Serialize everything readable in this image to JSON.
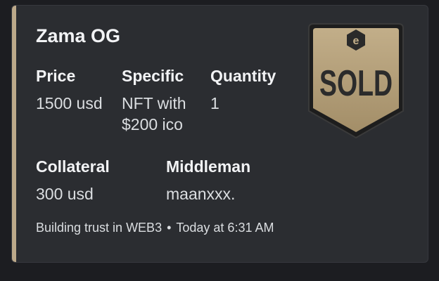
{
  "embed": {
    "accent_color": "#bca98a",
    "title": "Zama OG",
    "fields": {
      "price": {
        "name": "Price",
        "value": "1500 usd"
      },
      "specific": {
        "name": "Specific",
        "value": "NFT with $200 ico"
      },
      "quantity": {
        "name": "Quantity",
        "value": "1"
      },
      "collateral": {
        "name": "Collateral",
        "value": "300 usd"
      },
      "middleman": {
        "name": "Middleman",
        "value": "maanxxx."
      }
    },
    "footer": {
      "text": "Building trust in WEB3",
      "separator": "•",
      "timestamp": "Today at 6:31 AM"
    },
    "thumbnail": {
      "icon": "sold-badge-icon",
      "label": "SOLD",
      "logo_icon": "hexagon-e-logo-icon",
      "badge_color": "#b39e78",
      "text_color": "#2b2b2b"
    }
  }
}
